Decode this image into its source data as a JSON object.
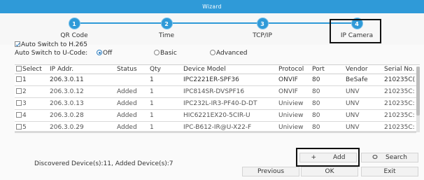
{
  "window": {
    "title": "Wizard"
  },
  "wizard": {
    "steps": [
      {
        "number": "1",
        "label": "QR Code"
      },
      {
        "number": "2",
        "label": "Time"
      },
      {
        "number": "3",
        "label": "TCP/IP"
      },
      {
        "number": "4",
        "label": "IP Camera"
      }
    ],
    "current_step": "IP Camera"
  },
  "options": {
    "auto_switch_h265": {
      "label": "Auto Switch to H.265",
      "checked": true
    },
    "ucode": {
      "label": "Auto Switch to U-Code:",
      "choices": [
        "Off",
        "Basic",
        "Advanced"
      ],
      "selected": "Off"
    }
  },
  "table": {
    "columns": [
      "Select",
      "IP Addr.",
      "Status",
      "Qty",
      "Device Model",
      "Protocol",
      "Port",
      "Vendor",
      "Serial No."
    ],
    "rows": [
      [
        "1",
        "206.3.0.11",
        "",
        "1",
        "IPC2221ER-SPF36",
        "ONVIF",
        "80",
        "BeSafe",
        "210235C("
      ],
      [
        "2",
        "206.3.0.12",
        "Added",
        "1",
        "IPC814SR-DVSPF16",
        "ONVIF",
        "80",
        "UNV",
        "210235C:"
      ],
      [
        "3",
        "206.3.0.13",
        "Added",
        "1",
        "IPC232L-IR3-PF40-D-DT",
        "Uniview",
        "80",
        "UNV",
        "210235C:"
      ],
      [
        "4",
        "206.3.0.28",
        "Added",
        "1",
        "HIC6221EX20-5CIR-U",
        "Uniview",
        "80",
        "UNV",
        "210235C:"
      ],
      [
        "5",
        "206.3.0.29",
        "Added",
        "1",
        "IPC-B612-IR@U-X22-F",
        "Uniview",
        "80",
        "UNV",
        "210235C:"
      ]
    ]
  },
  "status": {
    "discovered_text": "Discovered Device(s):11, Added Device(s):7"
  },
  "buttons": {
    "add": "Add",
    "add_icon": "+",
    "search": "Search",
    "search_icon": "search-icon",
    "previous": "Previous",
    "ok": "OK",
    "exit": "Exit"
  },
  "colors": {
    "accent": "#2f9ad8",
    "titlebar": "#2f9ad8"
  }
}
